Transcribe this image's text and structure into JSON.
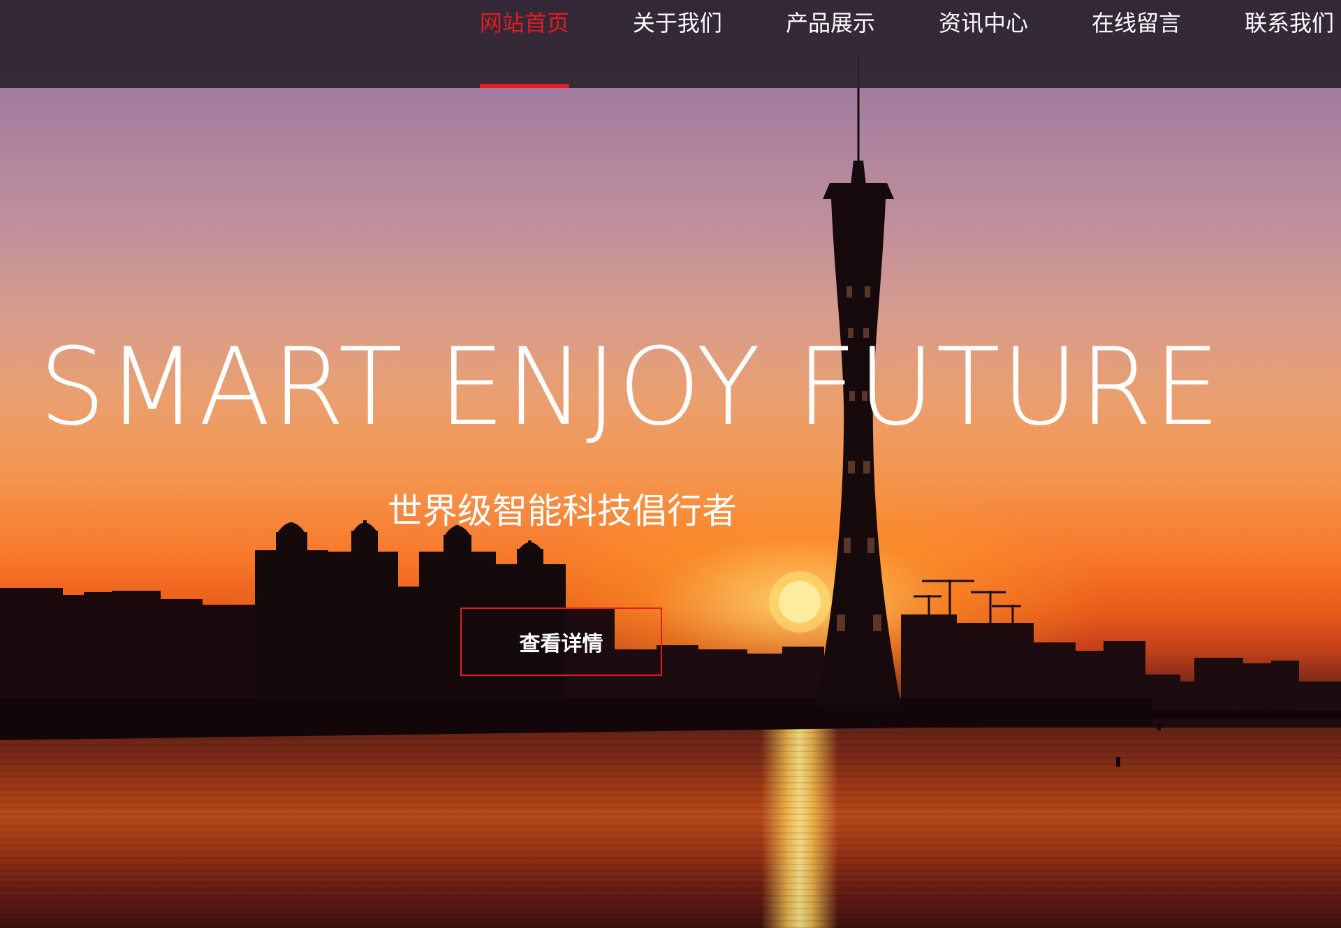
{
  "nav": {
    "items": [
      {
        "label": "网站首页",
        "active": true
      },
      {
        "label": "关于我们",
        "active": false
      },
      {
        "label": "产品展示",
        "active": false
      },
      {
        "label": "资讯中心",
        "active": false
      },
      {
        "label": "在线留言",
        "active": false
      },
      {
        "label": "联系我们",
        "active": false
      }
    ],
    "active_color": "#e31b23"
  },
  "hero": {
    "title": "SMART ENJOY FUTURE",
    "subtitle": "世界级智能科技倡行者",
    "button_label": "查看详情",
    "button_border_color": "#e31b23",
    "background": "sunset-city-skyline-with-tower"
  }
}
